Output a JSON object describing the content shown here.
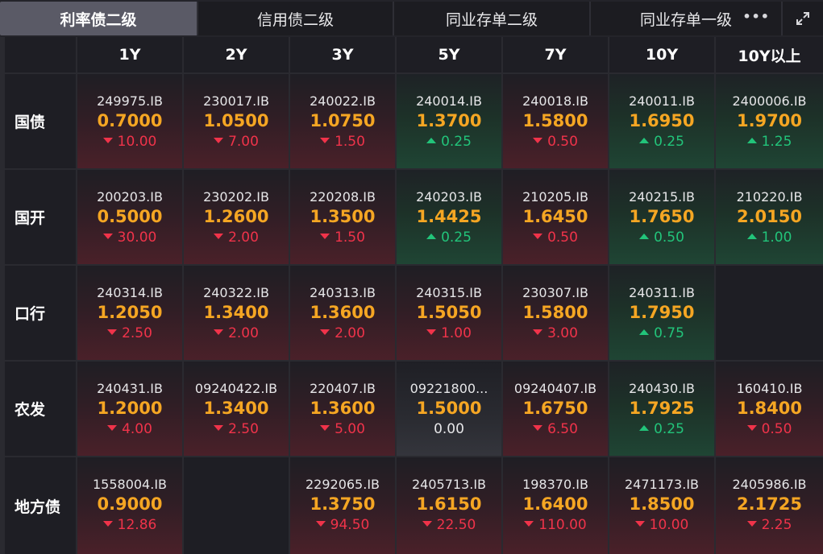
{
  "tabs": [
    {
      "label": "利率债二级",
      "active": true
    },
    {
      "label": "信用债二级",
      "active": false
    },
    {
      "label": "同业存单二级",
      "active": false
    },
    {
      "label": "同业存单一级",
      "active": false
    }
  ],
  "more_icon": "ellipsis-icon",
  "expand_icon": "expand-icon",
  "columns": [
    "1Y",
    "2Y",
    "3Y",
    "5Y",
    "7Y",
    "10Y",
    "10Y以上"
  ],
  "rows": [
    {
      "label": "国债",
      "cells": [
        {
          "code": "249975.IB",
          "yield": "0.7000",
          "change": "10.00",
          "dir": "down"
        },
        {
          "code": "230017.IB",
          "yield": "1.0500",
          "change": "7.00",
          "dir": "down"
        },
        {
          "code": "240022.IB",
          "yield": "1.0750",
          "change": "1.50",
          "dir": "down"
        },
        {
          "code": "240014.IB",
          "yield": "1.3700",
          "change": "0.25",
          "dir": "up"
        },
        {
          "code": "240018.IB",
          "yield": "1.5800",
          "change": "0.50",
          "dir": "down"
        },
        {
          "code": "240011.IB",
          "yield": "1.6950",
          "change": "0.25",
          "dir": "up"
        },
        {
          "code": "2400006.IB",
          "yield": "1.9700",
          "change": "1.25",
          "dir": "up"
        }
      ]
    },
    {
      "label": "国开",
      "cells": [
        {
          "code": "200203.IB",
          "yield": "0.5000",
          "change": "30.00",
          "dir": "down"
        },
        {
          "code": "230202.IB",
          "yield": "1.2600",
          "change": "2.00",
          "dir": "down"
        },
        {
          "code": "220208.IB",
          "yield": "1.3500",
          "change": "1.50",
          "dir": "down"
        },
        {
          "code": "240203.IB",
          "yield": "1.4425",
          "change": "0.25",
          "dir": "up"
        },
        {
          "code": "210205.IB",
          "yield": "1.6450",
          "change": "0.50",
          "dir": "down"
        },
        {
          "code": "240215.IB",
          "yield": "1.7650",
          "change": "0.50",
          "dir": "up"
        },
        {
          "code": "210220.IB",
          "yield": "2.0150",
          "change": "1.00",
          "dir": "up"
        }
      ]
    },
    {
      "label": "口行",
      "cells": [
        {
          "code": "240314.IB",
          "yield": "1.2050",
          "change": "2.50",
          "dir": "down"
        },
        {
          "code": "240322.IB",
          "yield": "1.3400",
          "change": "2.00",
          "dir": "down"
        },
        {
          "code": "240313.IB",
          "yield": "1.3600",
          "change": "2.00",
          "dir": "down"
        },
        {
          "code": "240315.IB",
          "yield": "1.5050",
          "change": "1.00",
          "dir": "down"
        },
        {
          "code": "230307.IB",
          "yield": "1.5800",
          "change": "3.00",
          "dir": "down"
        },
        {
          "code": "240311.IB",
          "yield": "1.7950",
          "change": "0.75",
          "dir": "up"
        },
        null
      ]
    },
    {
      "label": "农发",
      "cells": [
        {
          "code": "240431.IB",
          "yield": "1.2000",
          "change": "4.00",
          "dir": "down"
        },
        {
          "code": "09240422.IB",
          "yield": "1.3400",
          "change": "2.50",
          "dir": "down"
        },
        {
          "code": "220407.IB",
          "yield": "1.3600",
          "change": "5.00",
          "dir": "down"
        },
        {
          "code": "09221800...",
          "yield": "1.5000",
          "change": "0.00",
          "dir": "flat"
        },
        {
          "code": "09240407.IB",
          "yield": "1.6750",
          "change": "6.50",
          "dir": "down"
        },
        {
          "code": "240430.IB",
          "yield": "1.7925",
          "change": "0.25",
          "dir": "up"
        },
        {
          "code": "160410.IB",
          "yield": "1.8400",
          "change": "0.50",
          "dir": "down"
        }
      ]
    },
    {
      "label": "地方债",
      "cells": [
        {
          "code": "1558004.IB",
          "yield": "0.9000",
          "change": "12.86",
          "dir": "down"
        },
        null,
        {
          "code": "2292065.IB",
          "yield": "1.3750",
          "change": "94.50",
          "dir": "down"
        },
        {
          "code": "2405713.IB",
          "yield": "1.6150",
          "change": "22.50",
          "dir": "down"
        },
        {
          "code": "198370.IB",
          "yield": "1.6400",
          "change": "110.00",
          "dir": "down"
        },
        {
          "code": "2471173.IB",
          "yield": "1.8500",
          "change": "10.00",
          "dir": "down"
        },
        {
          "code": "2405986.IB",
          "yield": "2.1725",
          "change": "2.25",
          "dir": "down"
        }
      ]
    }
  ]
}
